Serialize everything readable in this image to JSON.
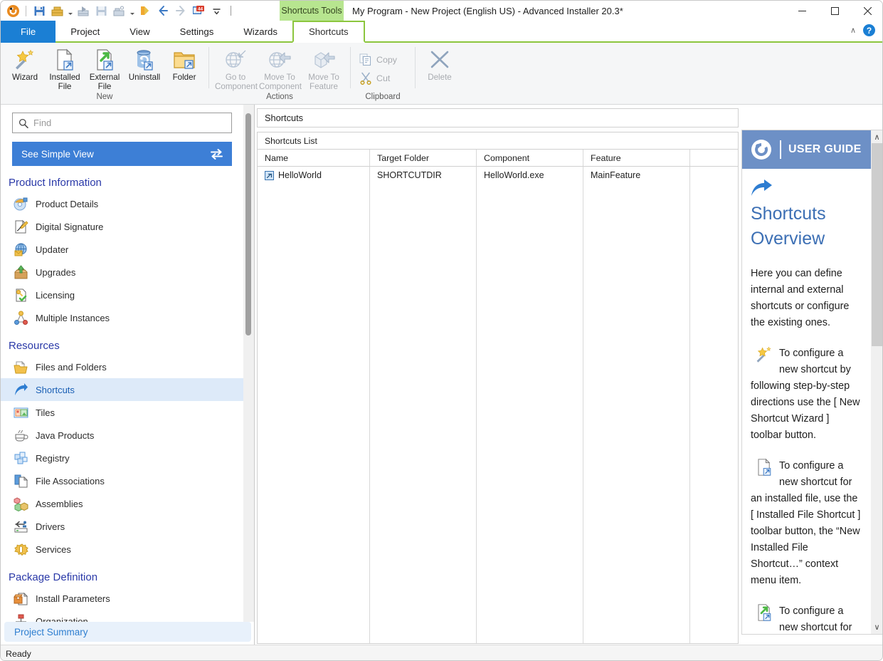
{
  "window": {
    "title": "My Program - New Project (English US) - Advanced Installer 20.3*",
    "contextual_tab_label": "Shortcuts Tools",
    "minimize": "—",
    "maximize": "☐",
    "close": "✕",
    "collapse_ribbon": "∧",
    "help": "?"
  },
  "quick_access": [
    {
      "name": "app-logo-icon"
    },
    {
      "name": "save-icon"
    },
    {
      "name": "build-icon"
    },
    {
      "name": "build-dropdown-caret"
    },
    {
      "name": "build-run-icon"
    },
    {
      "name": "save-as-icon"
    },
    {
      "name": "build-install-icon"
    },
    {
      "name": "build-install-caret"
    },
    {
      "name": "run-icon"
    },
    {
      "name": "back-icon"
    },
    {
      "name": "forward-icon"
    },
    {
      "name": "updates-icon",
      "badge": "44"
    },
    {
      "name": "customize-caret"
    }
  ],
  "tabs": [
    {
      "label": "File",
      "type": "file"
    },
    {
      "label": "Project",
      "type": "normal"
    },
    {
      "label": "View",
      "type": "normal"
    },
    {
      "label": "Settings",
      "type": "normal"
    },
    {
      "label": "Wizards",
      "type": "normal"
    },
    {
      "label": "Shortcuts",
      "type": "contextual-active"
    }
  ],
  "ribbon": {
    "groups": [
      {
        "title": "New",
        "buttons": [
          {
            "label": "Wizard",
            "icon": "wand-star-icon",
            "disabled": false
          },
          {
            "label": "Installed File",
            "icon": "installed-file-shortcut-icon",
            "disabled": false
          },
          {
            "label": "External File",
            "icon": "external-file-shortcut-icon",
            "disabled": false
          },
          {
            "label": "Uninstall",
            "icon": "uninstall-shortcut-icon",
            "disabled": false
          },
          {
            "label": "Folder",
            "icon": "folder-shortcut-icon",
            "disabled": false
          }
        ]
      },
      {
        "title": "Actions",
        "buttons": [
          {
            "label": "Go to Component",
            "icon": "go-to-component-icon",
            "disabled": true
          },
          {
            "label": "Move To Component",
            "icon": "move-to-component-icon",
            "disabled": true
          },
          {
            "label": "Move To Feature",
            "icon": "move-to-feature-icon",
            "disabled": true
          }
        ]
      },
      {
        "title": "Clipboard",
        "buttons": [
          {
            "label": "Copy",
            "icon": "copy-icon",
            "disabled": true
          },
          {
            "label": "Cut",
            "icon": "cut-icon",
            "disabled": true
          }
        ]
      },
      {
        "title": "",
        "buttons": [
          {
            "label": "Delete",
            "icon": "delete-x-icon",
            "disabled": true
          }
        ]
      }
    ]
  },
  "sidebar": {
    "find": {
      "placeholder": "Find",
      "value": "",
      "icon": "search-icon"
    },
    "simple_view": {
      "label": "See Simple View",
      "icon": "swap-arrows-icon"
    },
    "sections": [
      {
        "title": "Product Information",
        "items": [
          {
            "label": "Product Details",
            "icon": "product-details-icon"
          },
          {
            "label": "Digital Signature",
            "icon": "digital-signature-icon"
          },
          {
            "label": "Updater",
            "icon": "updater-icon"
          },
          {
            "label": "Upgrades",
            "icon": "upgrades-icon"
          },
          {
            "label": "Licensing",
            "icon": "licensing-key-icon"
          },
          {
            "label": "Multiple Instances",
            "icon": "multiple-instances-icon"
          }
        ]
      },
      {
        "title": "Resources",
        "items": [
          {
            "label": "Files and Folders",
            "icon": "files-and-folders-icon"
          },
          {
            "label": "Shortcuts",
            "icon": "shortcuts-arrow-icon",
            "selected": true
          },
          {
            "label": "Tiles",
            "icon": "tiles-icon"
          },
          {
            "label": "Java Products",
            "icon": "java-coffee-icon"
          },
          {
            "label": "Registry",
            "icon": "registry-icon"
          },
          {
            "label": "File Associations",
            "icon": "file-associations-icon"
          },
          {
            "label": "Assemblies",
            "icon": "assemblies-icon"
          },
          {
            "label": "Drivers",
            "icon": "drivers-usb-icon"
          },
          {
            "label": "Services",
            "icon": "services-gear-icon"
          }
        ]
      },
      {
        "title": "Package Definition",
        "items": [
          {
            "label": "Install Parameters",
            "icon": "install-parameters-icon"
          },
          {
            "label": "Organization",
            "icon": "organization-icon"
          }
        ]
      }
    ],
    "project_summary": "Project Summary"
  },
  "main": {
    "panel_title": "Shortcuts",
    "list_title": "Shortcuts List",
    "columns": [
      "Name",
      "Target Folder",
      "Component",
      "Feature"
    ],
    "rows": [
      {
        "icon": "shortcut-file-icon",
        "Name": "HelloWorld",
        "Target Folder": "SHORTCUTDIR",
        "Component": "HelloWorld.exe",
        "Feature": "MainFeature"
      }
    ]
  },
  "guide": {
    "header_title": "USER GUIDE",
    "header_icon": "advanced-installer-logo-icon",
    "topic_icon": "shortcuts-arrow-icon",
    "title": "Shortcuts Overview",
    "intro": "Here you can define internal and external shortcuts or configure the existing ones.",
    "bullets": [
      {
        "icon": "wand-star-icon",
        "text": "To configure a new shortcut by following step-by-step directions use the [ New Shortcut Wizard ] toolbar button."
      },
      {
        "icon": "installed-file-shortcut-icon",
        "text": "To configure a new shortcut for an installed file, use the [ Installed File Shortcut ] toolbar button, the “New Installed File Shortcut…” context menu item."
      },
      {
        "icon": "external-file-shortcut-icon",
        "text": "To configure a new shortcut for an external file, use the"
      }
    ],
    "scroll_up": "∧",
    "scroll_down": "∨"
  },
  "statusbar": {
    "text": "Ready"
  },
  "colors": {
    "accent_blue": "#1b7fd4",
    "contextual_green": "#8cc63e",
    "contextual_green_fill": "#b7e58f",
    "simple_view_blue": "#3d7fd6",
    "selected_item_bg": "#ddeaf9",
    "guide_header_blue": "#6d90c6",
    "section_heading": "#2a39a8"
  }
}
